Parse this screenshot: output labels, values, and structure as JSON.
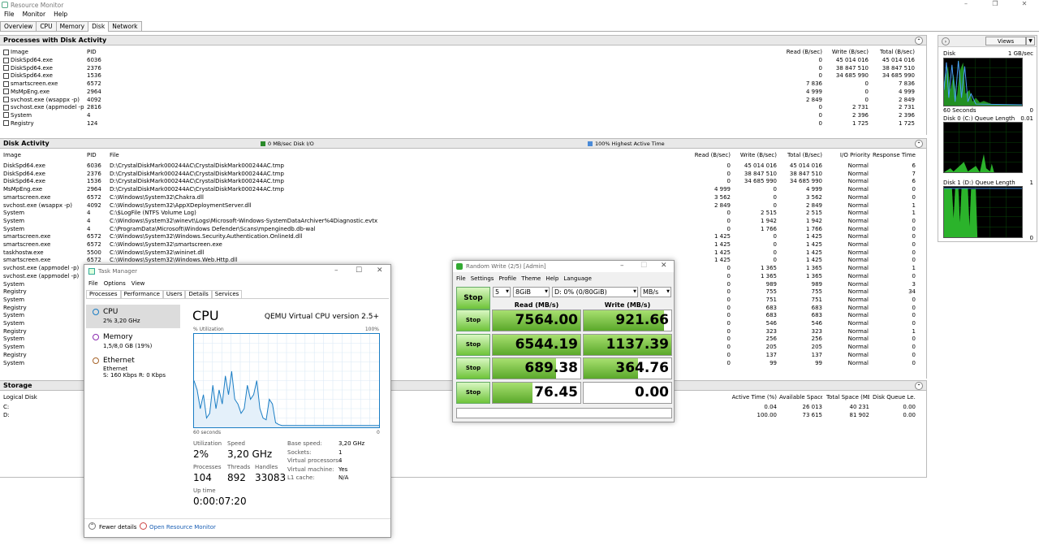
{
  "window": {
    "title": "Resource Monitor"
  },
  "menu": [
    "File",
    "Monitor",
    "Help"
  ],
  "tabs": [
    "Overview",
    "CPU",
    "Memory",
    "Disk",
    "Network"
  ],
  "proc": {
    "title": "Processes with Disk Activity",
    "headers": {
      "image": "Image",
      "pid": "PID",
      "read": "Read (B/sec)",
      "write": "Write (B/sec)",
      "total": "Total (B/sec)"
    },
    "rows": [
      {
        "image": "DiskSpd64.exe",
        "pid": "6036",
        "read": "0",
        "write": "45 014 016",
        "total": "45 014 016"
      },
      {
        "image": "DiskSpd64.exe",
        "pid": "2376",
        "read": "0",
        "write": "38 847 510",
        "total": "38 847 510"
      },
      {
        "image": "DiskSpd64.exe",
        "pid": "1536",
        "read": "0",
        "write": "34 685 990",
        "total": "34 685 990"
      },
      {
        "image": "smartscreen.exe",
        "pid": "6572",
        "read": "7 836",
        "write": "0",
        "total": "7 836"
      },
      {
        "image": "MsMpEng.exe",
        "pid": "2964",
        "read": "4 999",
        "write": "0",
        "total": "4 999"
      },
      {
        "image": "svchost.exe (wsappx -p)",
        "pid": "4092",
        "read": "2 849",
        "write": "0",
        "total": "2 849"
      },
      {
        "image": "svchost.exe (appmodel -p)",
        "pid": "2816",
        "read": "0",
        "write": "2 731",
        "total": "2 731"
      },
      {
        "image": "System",
        "pid": "4",
        "read": "0",
        "write": "2 396",
        "total": "2 396"
      },
      {
        "image": "Registry",
        "pid": "124",
        "read": "0",
        "write": "1 725",
        "total": "1 725"
      }
    ]
  },
  "disk": {
    "title": "Disk Activity",
    "io": "0 MB/sec Disk I/O",
    "active": "100% Highest Active Time",
    "headers": {
      "image": "Image",
      "pid": "PID",
      "file": "File",
      "read": "Read (B/sec)",
      "write": "Write (B/sec)",
      "total": "Total (B/sec)",
      "prio": "I/O Priority",
      "resp": "Response Time..."
    },
    "rows": [
      {
        "image": "DiskSpd64.exe",
        "pid": "6036",
        "file": "D:\\CrystalDiskMark000244AC\\CrystalDiskMark000244AC.tmp",
        "read": "0",
        "write": "45 014 016",
        "total": "45 014 016",
        "prio": "Normal",
        "resp": "6"
      },
      {
        "image": "DiskSpd64.exe",
        "pid": "2376",
        "file": "D:\\CrystalDiskMark000244AC\\CrystalDiskMark000244AC.tmp",
        "read": "0",
        "write": "38 847 510",
        "total": "38 847 510",
        "prio": "Normal",
        "resp": "7"
      },
      {
        "image": "DiskSpd64.exe",
        "pid": "1536",
        "file": "D:\\CrystalDiskMark000244AC\\CrystalDiskMark000244AC.tmp",
        "read": "0",
        "write": "34 685 990",
        "total": "34 685 990",
        "prio": "Normal",
        "resp": "6"
      },
      {
        "image": "MsMpEng.exe",
        "pid": "2964",
        "file": "D:\\CrystalDiskMark000244AC\\CrystalDiskMark000244AC.tmp",
        "read": "4 999",
        "write": "0",
        "total": "4 999",
        "prio": "Normal",
        "resp": "0"
      },
      {
        "image": "smartscreen.exe",
        "pid": "6572",
        "file": "C:\\Windows\\System32\\Chakra.dll",
        "read": "3 562",
        "write": "0",
        "total": "3 562",
        "prio": "Normal",
        "resp": "0"
      },
      {
        "image": "svchost.exe (wsappx -p)",
        "pid": "4092",
        "file": "C:\\Windows\\System32\\AppXDeploymentServer.dll",
        "read": "2 849",
        "write": "0",
        "total": "2 849",
        "prio": "Normal",
        "resp": "1"
      },
      {
        "image": "System",
        "pid": "4",
        "file": "C:\\$LogFile (NTFS Volume Log)",
        "read": "0",
        "write": "2 515",
        "total": "2 515",
        "prio": "Normal",
        "resp": "1"
      },
      {
        "image": "System",
        "pid": "4",
        "file": "C:\\Windows\\System32\\winevt\\Logs\\Microsoft-Windows-SystemDataArchiver%4Diagnostic.evtx",
        "read": "0",
        "write": "1 942",
        "total": "1 942",
        "prio": "Normal",
        "resp": "0"
      },
      {
        "image": "System",
        "pid": "4",
        "file": "C:\\ProgramData\\Microsoft\\Windows Defender\\Scans\\mpenginedb.db-wal",
        "read": "0",
        "write": "1 766",
        "total": "1 766",
        "prio": "Normal",
        "resp": "0"
      },
      {
        "image": "smartscreen.exe",
        "pid": "6572",
        "file": "C:\\Windows\\System32\\Windows.Security.Authentication.OnlineId.dll",
        "read": "1 425",
        "write": "0",
        "total": "1 425",
        "prio": "Normal",
        "resp": "0"
      },
      {
        "image": "smartscreen.exe",
        "pid": "6572",
        "file": "C:\\Windows\\System32\\smartscreen.exe",
        "read": "1 425",
        "write": "0",
        "total": "1 425",
        "prio": "Normal",
        "resp": "0"
      },
      {
        "image": "taskhostw.exe",
        "pid": "5500",
        "file": "C:\\Windows\\System32\\wininet.dll",
        "read": "1 425",
        "write": "0",
        "total": "1 425",
        "prio": "Normal",
        "resp": "0"
      },
      {
        "image": "smartscreen.exe",
        "pid": "6572",
        "file": "C:\\Windows\\System32\\Windows.Web.Http.dll",
        "read": "1 425",
        "write": "0",
        "total": "1 425",
        "prio": "Normal",
        "resp": "0"
      },
      {
        "image": "svchost.exe (appmodel -p)",
        "pid": "",
        "file": "",
        "read": "0",
        "write": "1 365",
        "total": "1 365",
        "prio": "Normal",
        "resp": "1"
      },
      {
        "image": "svchost.exe (appmodel -p)",
        "pid": "",
        "file": "",
        "read": "0",
        "write": "1 365",
        "total": "1 365",
        "prio": "Normal",
        "resp": "0"
      },
      {
        "image": "System",
        "pid": "",
        "file": "",
        "read": "0",
        "write": "989",
        "total": "989",
        "prio": "Normal",
        "resp": "3"
      },
      {
        "image": "Registry",
        "pid": "",
        "file": "",
        "read": "0",
        "write": "755",
        "total": "755",
        "prio": "Normal",
        "resp": "34"
      },
      {
        "image": "System",
        "pid": "",
        "file": "",
        "read": "0",
        "write": "751",
        "total": "751",
        "prio": "Normal",
        "resp": "0"
      },
      {
        "image": "Registry",
        "pid": "",
        "file": "",
        "read": "0",
        "write": "683",
        "total": "683",
        "prio": "Normal",
        "resp": "0"
      },
      {
        "image": "System",
        "pid": "",
        "file": "",
        "read": "0",
        "write": "683",
        "total": "683",
        "prio": "Normal",
        "resp": "0"
      },
      {
        "image": "System",
        "pid": "",
        "file": "",
        "read": "0",
        "write": "546",
        "total": "546",
        "prio": "Normal",
        "resp": "0"
      },
      {
        "image": "Registry",
        "pid": "",
        "file": "",
        "read": "0",
        "write": "323",
        "total": "323",
        "prio": "Normal",
        "resp": "1"
      },
      {
        "image": "System",
        "pid": "",
        "file": "",
        "read": "0",
        "write": "256",
        "total": "256",
        "prio": "Normal",
        "resp": "0"
      },
      {
        "image": "System",
        "pid": "",
        "file": "",
        "read": "0",
        "write": "205",
        "total": "205",
        "prio": "Normal",
        "resp": "0"
      },
      {
        "image": "Registry",
        "pid": "",
        "file": "",
        "read": "0",
        "write": "137",
        "total": "137",
        "prio": "Normal",
        "resp": "0"
      },
      {
        "image": "System",
        "pid": "",
        "file": "",
        "read": "0",
        "write": "99",
        "total": "99",
        "prio": "Normal",
        "resp": "0"
      }
    ]
  },
  "storage": {
    "title": "Storage",
    "headers": {
      "disk": "Logical Disk",
      "active": "Active Time (%)",
      "avail": "Available Space...",
      "totalsp": "Total Space (MB)",
      "queue": "Disk Queue Le..."
    },
    "rows": [
      {
        "disk": "C:",
        "active": "0.04",
        "avail": "26 013",
        "totalsp": "40 231",
        "queue": "0.00"
      },
      {
        "disk": "D:",
        "active": "100.00",
        "avail": "73 615",
        "totalsp": "81 902",
        "queue": "0.00"
      }
    ]
  },
  "side": {
    "views": "Views",
    "disk_label": "Disk",
    "disk_max": "1 GB/sec",
    "sixty": "60 Seconds",
    "zero": "0",
    "q0_label": "Disk 0 (C:) Queue Length",
    "q0_max": "0.01",
    "q1_label": "Disk 1 (D:) Queue Length",
    "q1_max": "1"
  },
  "tm": {
    "title": "Task Manager",
    "menu": [
      "File",
      "Options",
      "View"
    ],
    "tabs": [
      "Processes",
      "Performance",
      "Users",
      "Details",
      "Services"
    ],
    "items": [
      {
        "name": "CPU",
        "sub": "2% 3,20 GHz",
        "color": "#1a7dc4"
      },
      {
        "name": "Memory",
        "sub": "1,5/8,0 GB (19%)",
        "color": "#8b2cb0"
      },
      {
        "name": "Ethernet",
        "sub": "Ethernet",
        "sub2": "S: 160 Kbps  R: 0 Kbps",
        "color": "#a7642a"
      }
    ],
    "heading": "CPU",
    "model": "QEMU Virtual CPU version 2.5+",
    "util_label": "% Utilization",
    "util_max": "100%",
    "x_left": "60 seconds",
    "x_right": "0",
    "stats": {
      "util_l": "Utilization",
      "util_v": "2%",
      "speed_l": "Speed",
      "speed_v": "3,20 GHz",
      "proc_l": "Processes",
      "proc_v": "104",
      "thr_l": "Threads",
      "thr_v": "892",
      "han_l": "Handles",
      "han_v": "33083",
      "up_l": "Up time",
      "up_v": "0:00:07:20"
    },
    "info": [
      {
        "k": "Base speed:",
        "v": "3,20 GHz"
      },
      {
        "k": "Sockets:",
        "v": "1"
      },
      {
        "k": "Virtual processors:",
        "v": "4"
      },
      {
        "k": "Virtual machine:",
        "v": "Yes"
      },
      {
        "k": "L1 cache:",
        "v": "N/A"
      }
    ],
    "fewer": "Fewer details",
    "open_rm": "Open Resource Monitor",
    "chart_data": {
      "type": "area",
      "x_range": [
        60,
        0
      ],
      "ylim": [
        0,
        100
      ],
      "values": [
        50,
        40,
        20,
        35,
        10,
        15,
        45,
        20,
        40,
        25,
        55,
        35,
        60,
        30,
        25,
        15,
        20,
        45,
        30,
        35,
        50,
        20,
        10,
        8,
        30,
        25,
        5,
        3,
        2,
        2,
        2,
        2,
        2,
        2,
        2,
        2,
        2,
        2,
        2,
        2,
        2,
        2,
        2,
        2,
        2,
        2,
        2,
        2,
        2,
        2,
        2,
        2,
        2,
        2,
        2,
        2,
        2,
        2,
        2,
        2
      ]
    }
  },
  "cdm": {
    "title": "Random Write (2/5) [Admin]",
    "menu": [
      "File",
      "Settings",
      "Profile",
      "Theme",
      "Help",
      "Language"
    ],
    "count": "5",
    "size": "8GiB",
    "drive": "D: 0% (0/80GiB)",
    "unit": "MB/s",
    "read_h": "Read (MB/s)",
    "write_h": "Write (MB/s)",
    "stop": "Stop",
    "rows": [
      {
        "read": "7564.00",
        "write": "921.66",
        "rf": 1.0,
        "wf": 0.92
      },
      {
        "read": "6544.19",
        "write": "1137.39",
        "rf": 1.0,
        "wf": 1.0
      },
      {
        "read": "689.38",
        "write": "364.76",
        "rf": 0.72,
        "wf": 0.62
      },
      {
        "read": "76.45",
        "write": "0.00",
        "rf": 0.45,
        "wf": 0
      }
    ]
  }
}
